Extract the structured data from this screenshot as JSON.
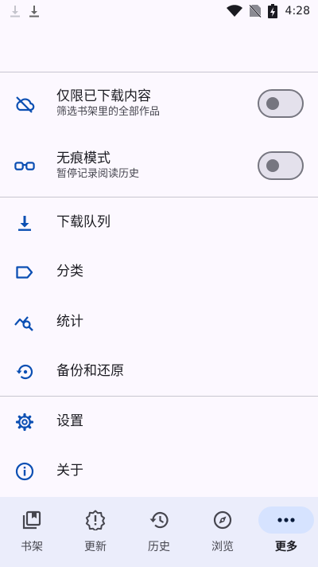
{
  "status_bar": {
    "time": "4:28",
    "left_icons": [
      "download-icon",
      "download-icon"
    ],
    "right_icons": [
      "wifi-icon",
      "no-sim-icon",
      "battery-charging-icon"
    ]
  },
  "settings": {
    "downloaded_only": {
      "title": "仅限已下载内容",
      "subtitle": "筛选书架里的全部作品",
      "icon": "cloud-off-icon",
      "enabled": false
    },
    "incognito": {
      "title": "无痕模式",
      "subtitle": "暂停记录阅读历史",
      "icon": "glasses-icon",
      "enabled": false
    }
  },
  "menu": {
    "download_queue": "下载队列",
    "categories": "分类",
    "stats": "统计",
    "backup_restore": "备份和还原",
    "settings": "设置",
    "about": "关于"
  },
  "bottom_nav": {
    "items": [
      {
        "label": "书架",
        "icon": "library-icon"
      },
      {
        "label": "更新",
        "icon": "updates-icon"
      },
      {
        "label": "历史",
        "icon": "history-icon"
      },
      {
        "label": "浏览",
        "icon": "compass-icon"
      },
      {
        "label": "更多",
        "icon": "more-icon"
      }
    ],
    "active": "更多"
  },
  "colors": {
    "accent": "#0b4fb3",
    "background": "#fcf8ff",
    "nav_background": "#ebedfb",
    "active_pill": "#d6e3ff"
  }
}
